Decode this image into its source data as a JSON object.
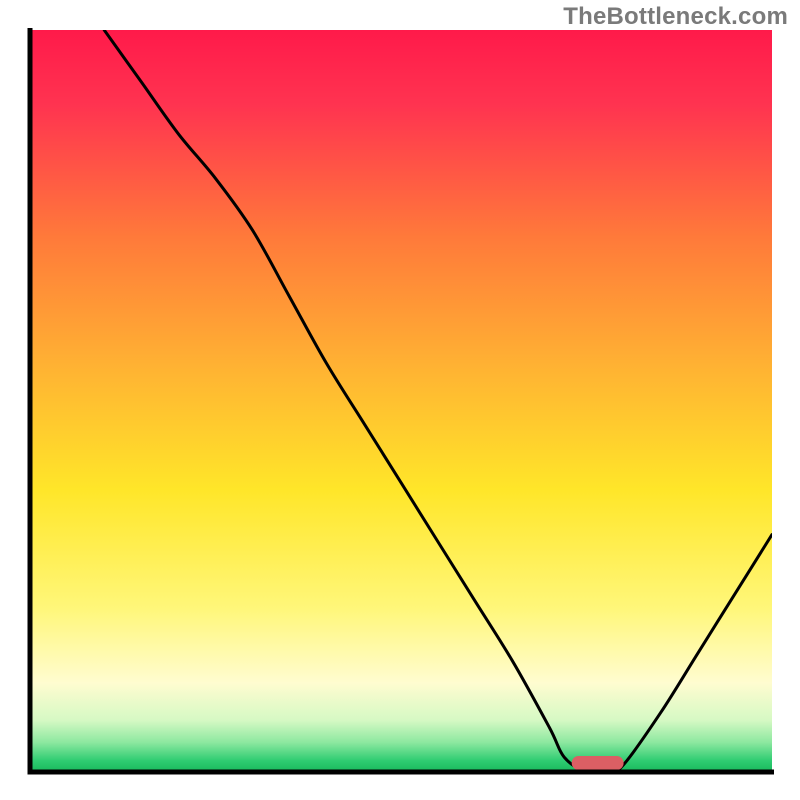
{
  "watermark": "TheBottleneck.com",
  "colors": {
    "gradient_top": "#ff1a4a",
    "gradient_mid_upper": "#ff9a2a",
    "gradient_mid": "#ffd726",
    "gradient_mid_lower": "#fff9b0",
    "gradient_green": "#22c55e",
    "curve_stroke": "#000000",
    "marker_fill": "#db5f64",
    "frame_stroke": "#000000"
  },
  "chart_data": {
    "type": "line",
    "title": "",
    "xlabel": "",
    "ylabel": "",
    "xlim": [
      0,
      100
    ],
    "ylim": [
      0,
      100
    ],
    "x": [
      10,
      15,
      20,
      25,
      30,
      35,
      40,
      45,
      50,
      55,
      60,
      65,
      70,
      72,
      75,
      78,
      80,
      85,
      90,
      95,
      100
    ],
    "values": [
      100,
      93,
      86,
      80,
      73,
      64,
      55,
      47,
      39,
      31,
      23,
      15,
      6,
      2,
      0,
      0,
      1,
      8,
      16,
      24,
      32
    ],
    "optimal_range_x": [
      73,
      80
    ],
    "annotations": [
      {
        "text": "TheBottleneck.com",
        "role": "watermark"
      }
    ]
  }
}
